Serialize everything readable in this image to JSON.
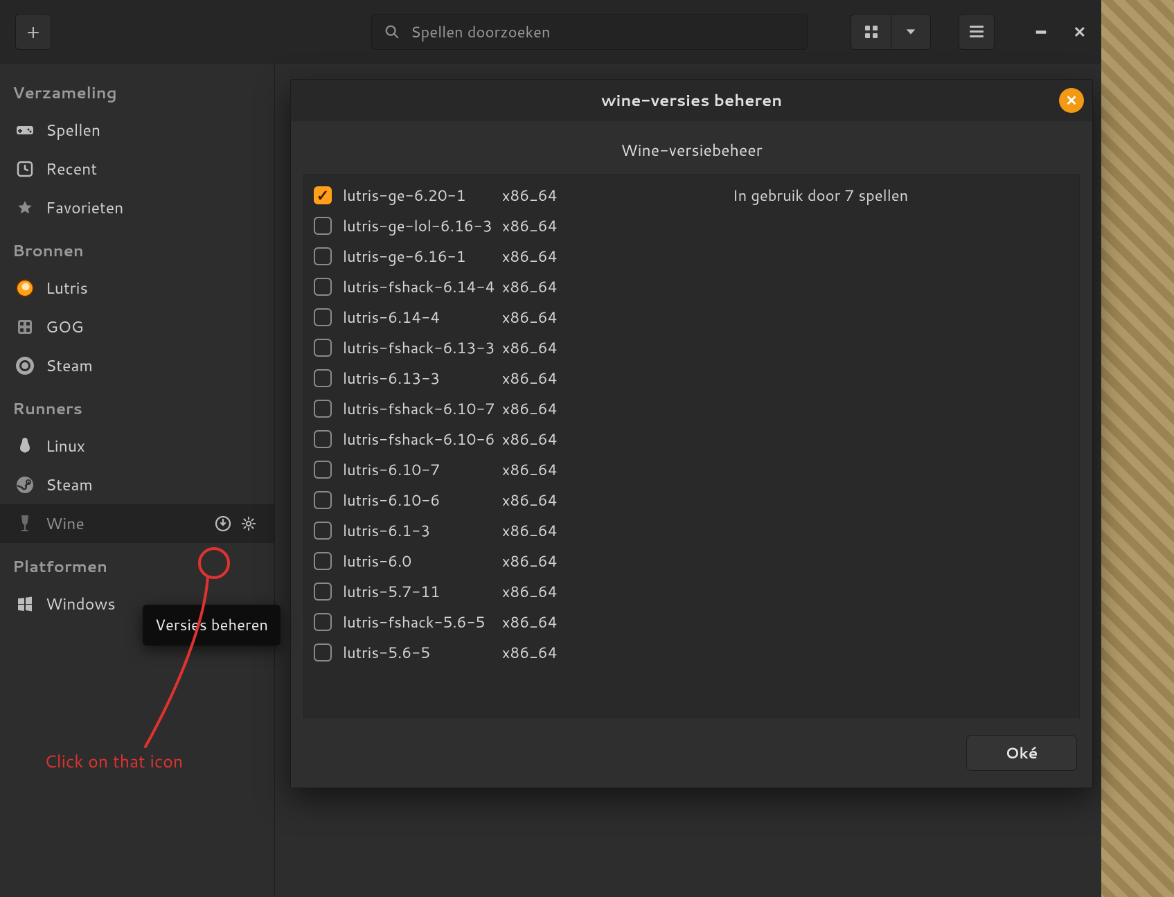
{
  "header": {
    "search_placeholder": "Spellen doorzoeken"
  },
  "sidebar": {
    "section_collection": "Verzameling",
    "section_sources": "Bronnen",
    "section_runners": "Runners",
    "section_platforms": "Platformen",
    "items": {
      "games": {
        "label": "Spellen",
        "icon": "gamepad-icon"
      },
      "recent": {
        "label": "Recent",
        "icon": "clock-icon"
      },
      "favorites": {
        "label": "Favorieten",
        "icon": "star-icon"
      },
      "lutris": {
        "label": "Lutris",
        "icon": "lutris-icon"
      },
      "gog": {
        "label": "GOG",
        "icon": "gog-icon"
      },
      "steam_src": {
        "label": "Steam",
        "icon": "steam-icon"
      },
      "linux": {
        "label": "Linux",
        "icon": "penguin-icon"
      },
      "steam_run": {
        "label": "Steam",
        "icon": "steam-icon"
      },
      "wine": {
        "label": "Wine",
        "icon": "wine-icon"
      },
      "windows": {
        "label": "Windows",
        "icon": "windows-icon"
      }
    }
  },
  "tooltip": "Versies beheren",
  "annotation_text": "Click on that icon",
  "dialog": {
    "title": "wine-versies beheren",
    "subtitle": "Wine-versiebeheer",
    "ok": "Oké",
    "in_use": "In gebruik door 7 spellen",
    "versions": [
      {
        "name": "lutris-ge-6.20-1",
        "arch": "x86_64",
        "checked": true,
        "in_use": true
      },
      {
        "name": "lutris-ge-lol-6.16-3",
        "arch": "x86_64",
        "checked": false,
        "in_use": false
      },
      {
        "name": "lutris-ge-6.16-1",
        "arch": "x86_64",
        "checked": false,
        "in_use": false
      },
      {
        "name": "lutris-fshack-6.14-4",
        "arch": "x86_64",
        "checked": false,
        "in_use": false
      },
      {
        "name": "lutris-6.14-4",
        "arch": "x86_64",
        "checked": false,
        "in_use": false
      },
      {
        "name": "lutris-fshack-6.13-3",
        "arch": "x86_64",
        "checked": false,
        "in_use": false
      },
      {
        "name": "lutris-6.13-3",
        "arch": "x86_64",
        "checked": false,
        "in_use": false
      },
      {
        "name": "lutris-fshack-6.10-7",
        "arch": "x86_64",
        "checked": false,
        "in_use": false
      },
      {
        "name": "lutris-fshack-6.10-6",
        "arch": "x86_64",
        "checked": false,
        "in_use": false
      },
      {
        "name": "lutris-6.10-7",
        "arch": "x86_64",
        "checked": false,
        "in_use": false
      },
      {
        "name": "lutris-6.10-6",
        "arch": "x86_64",
        "checked": false,
        "in_use": false
      },
      {
        "name": "lutris-6.1-3",
        "arch": "x86_64",
        "checked": false,
        "in_use": false
      },
      {
        "name": "lutris-6.0",
        "arch": "x86_64",
        "checked": false,
        "in_use": false
      },
      {
        "name": "lutris-5.7-11",
        "arch": "x86_64",
        "checked": false,
        "in_use": false
      },
      {
        "name": "lutris-fshack-5.6-5",
        "arch": "x86_64",
        "checked": false,
        "in_use": false
      },
      {
        "name": "lutris-5.6-5",
        "arch": "x86_64",
        "checked": false,
        "in_use": false
      }
    ]
  },
  "colors": {
    "accent": "#ff9f1a",
    "annotation": "#e0322e"
  }
}
